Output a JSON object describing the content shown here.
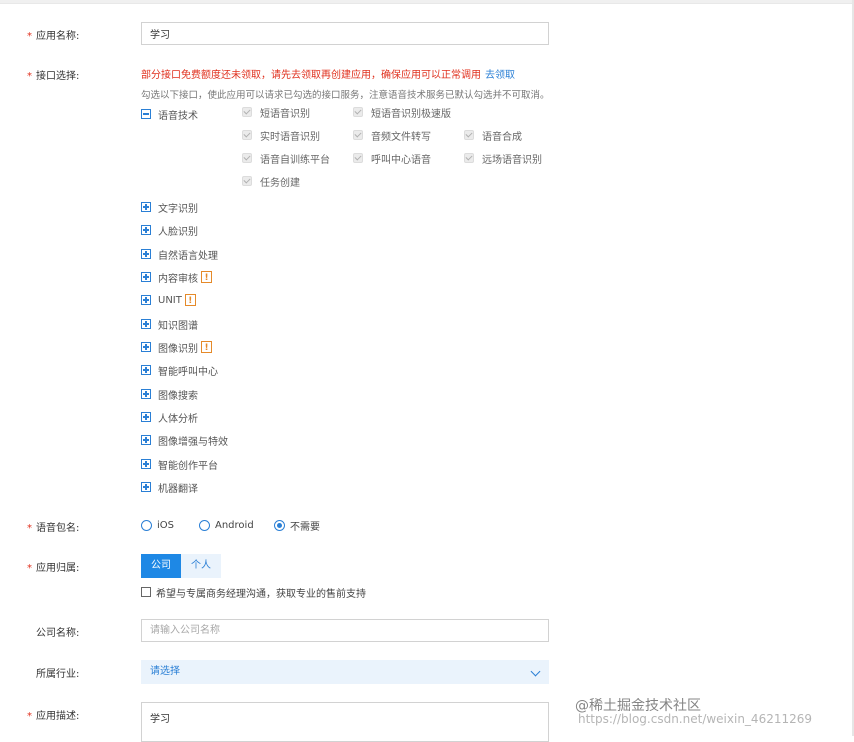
{
  "form": {
    "app_name": {
      "label": "应用名称:",
      "value": "学习"
    },
    "api_select": {
      "label": "接口选择:",
      "warning": "部分接口免费额度还未领取，请先去领取再创建应用，确保应用可以正常调用",
      "warning_link": "去领取",
      "hint": "勾选以下接口，使此应用可以请求已勾选的接口服务，注意语音技术服务已默认勾选并不可取消。",
      "speech_group": {
        "label": "语音技术",
        "items": [
          "短语音识别",
          "短语音识别极速版",
          "实时语音识别",
          "音频文件转写",
          "语音合成",
          "语音自训练平台",
          "呼叫中心语音",
          "远场语音识别",
          "任务创建"
        ]
      },
      "categories": [
        {
          "label": "文字识别",
          "badge": ""
        },
        {
          "label": "人脸识别",
          "badge": ""
        },
        {
          "label": "自然语言处理",
          "badge": ""
        },
        {
          "label": "内容审核",
          "badge": "!"
        },
        {
          "label": "UNIT",
          "badge": "!"
        },
        {
          "label": "知识图谱",
          "badge": ""
        },
        {
          "label": "图像识别",
          "badge": "!"
        },
        {
          "label": "智能呼叫中心",
          "badge": ""
        },
        {
          "label": "图像搜索",
          "badge": ""
        },
        {
          "label": "人体分析",
          "badge": ""
        },
        {
          "label": "图像增强与特效",
          "badge": ""
        },
        {
          "label": "智能创作平台",
          "badge": ""
        },
        {
          "label": "机器翻译",
          "badge": ""
        }
      ]
    },
    "voice_package": {
      "label": "语音包名:",
      "options": [
        "iOS",
        "Android",
        "不需要"
      ],
      "selected": "不需要"
    },
    "ownership": {
      "label": "应用归属:",
      "options": [
        "公司",
        "个人"
      ],
      "selected": "公司",
      "agree_text": "希望与专属商务经理沟通，获取专业的售前支持"
    },
    "company_name": {
      "label": "公司名称:",
      "placeholder": "请输入公司名称"
    },
    "industry": {
      "label": "所属行业:",
      "value": "请选择"
    },
    "description": {
      "label": "应用描述:",
      "value": "学习"
    }
  },
  "watermark": {
    "brand": "@稀土掘金技术社区",
    "url": "https://blog.csdn.net/weixin_46211269"
  },
  "colors": {
    "accent": "#1e88e5",
    "required": "#e0301e",
    "badge": "#e58a2a"
  }
}
